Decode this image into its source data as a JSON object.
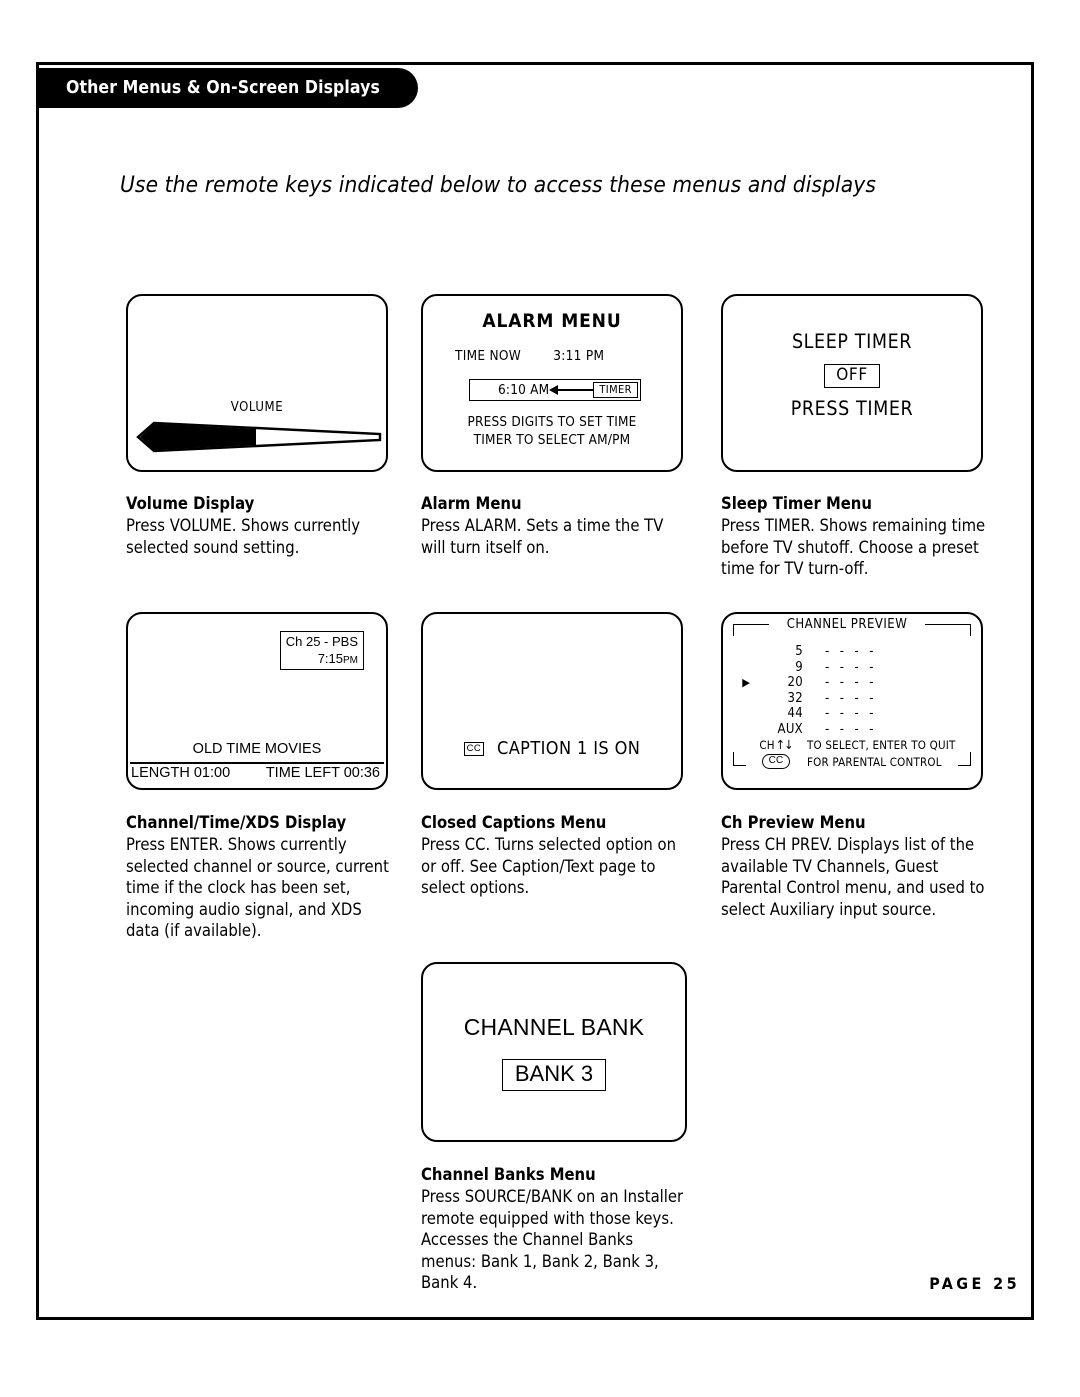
{
  "header": {
    "tab_title": "Other Menus & On-Screen Displays"
  },
  "intro": "Use the remote keys indicated below to access these menus and displays",
  "screens": {
    "volume": {
      "label": "VOLUME",
      "fill_percent": 48
    },
    "alarm": {
      "title": "ALARM MENU",
      "time_now_label": "TIME NOW",
      "time_now_value": "3:11 PM",
      "alarm_time": "6:10 AM",
      "timer_chip": "TIMER",
      "hint_line1": "PRESS DIGITS TO SET TIME",
      "hint_line2": "TIMER TO SELECT AM/PM"
    },
    "sleep": {
      "title": "SLEEP TIMER",
      "value": "OFF",
      "press": "PRESS TIMER"
    },
    "xds": {
      "channel": "Ch 25 - PBS",
      "time": "7:15",
      "ampm": "PM",
      "program": "OLD TIME MOVIES",
      "length": "LENGTH 01:00",
      "time_left": "TIME LEFT 00:36"
    },
    "caption": {
      "badge": "CC",
      "text": "CAPTION 1 IS ON"
    },
    "preview": {
      "title": "CHANNEL PREVIEW",
      "rows": [
        {
          "marker": "",
          "number": "5",
          "dashes": "- - - -"
        },
        {
          "marker": "",
          "number": "9",
          "dashes": "- - - -"
        },
        {
          "marker": "▶",
          "number": "20",
          "dashes": "- - - -"
        },
        {
          "marker": "",
          "number": "32",
          "dashes": "- - - -"
        },
        {
          "marker": "",
          "number": "44",
          "dashes": "- - - -"
        },
        {
          "marker": "",
          "number": "AUX",
          "dashes": "- - - -"
        }
      ],
      "foot_key_1": "CH",
      "foot_arrows_1": "↑↓",
      "foot_text_1": "TO SELECT, ENTER TO QUIT",
      "foot_key_2": "CC",
      "foot_text_2": "FOR PARENTAL CONTROL"
    },
    "bank": {
      "title": "CHANNEL BANK",
      "value": "BANK 3"
    }
  },
  "captions": {
    "volume": {
      "title": "Volume Display",
      "body": "Press VOLUME. Shows currently selected sound setting."
    },
    "alarm": {
      "title": "Alarm Menu",
      "body": "Press ALARM. Sets a time the TV will turn itself on."
    },
    "sleep": {
      "title": "Sleep Timer Menu",
      "body": "Press TIMER. Shows remaining time before TV shutoff. Choose a preset time for TV turn-off."
    },
    "xds": {
      "title": "Channel/Time/XDS Display",
      "body": "Press ENTER. Shows currently selected channel or source, current time if the clock has been set, incoming audio signal, and XDS data (if available)."
    },
    "caption": {
      "title": "Closed Captions Menu",
      "body": "Press CC. Turns selected option on or off. See Caption/Text page to select options."
    },
    "preview": {
      "title": "Ch Preview Menu",
      "body": "Press CH PREV. Displays list of the available TV Channels, Guest Parental Control menu, and used to select Auxiliary input source."
    },
    "bank": {
      "title": "Channel Banks Menu",
      "body": "Press SOURCE/BANK on an Installer remote equipped with those keys. Accesses the Channel Banks menus: Bank 1, Bank 2, Bank 3, Bank 4."
    }
  },
  "footer": {
    "page_label": "PAGE 25"
  },
  "colors": {
    "ink": "#000000",
    "paper": "#ffffff"
  }
}
